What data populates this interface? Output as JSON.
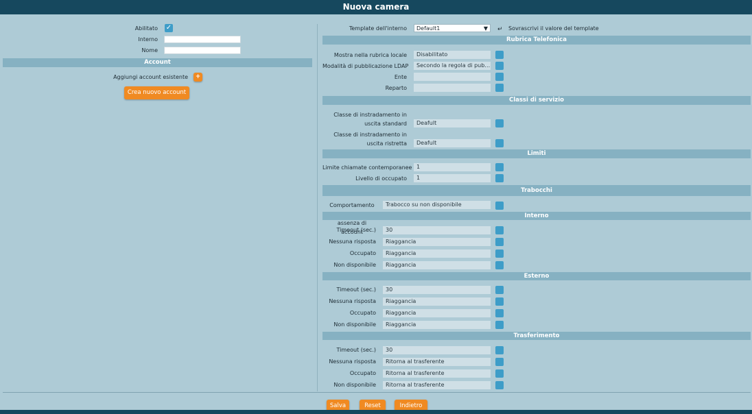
{
  "title": "Nuova camera",
  "left": {
    "abilitato_label": "Abilitato",
    "interno_label": "Interno",
    "interno_value": "",
    "nome_label": "Nome",
    "nome_value": "",
    "account_header": "Account",
    "add_existing_label": "Aggiungi account esistente",
    "add_icon": "+",
    "create_button": "Crea nuovo account"
  },
  "template": {
    "label": "Template dell'interno",
    "selected": "Default1",
    "override_label": "Sovrascrivi il valore del template",
    "override_icon": "undo-arrow-icon"
  },
  "sections": {
    "rubrica": {
      "title": "Rubrica Telefonica",
      "rows": [
        {
          "label": "Mostra nella rubrica locale",
          "value": "Disabilitato"
        },
        {
          "label": "Modalità di pubblicazione LDAP",
          "value": "Secondo la regola di pubblicazione"
        },
        {
          "label": "Ente",
          "value": ""
        },
        {
          "label": "Reparto",
          "value": ""
        }
      ]
    },
    "classi": {
      "title": "Classi di servizio",
      "rows": [
        {
          "label": "Classe di instradamento in uscita standard",
          "value": "Deafult"
        },
        {
          "label": "Classe di instradamento in uscita ristretta",
          "value": "Deafult"
        }
      ]
    },
    "limiti": {
      "title": "Limiti",
      "rows": [
        {
          "label": "Limite chiamate contemporanee",
          "value": "1"
        },
        {
          "label": "Livello di occupato",
          "value": "1"
        }
      ]
    },
    "trabocchi": {
      "title": "Trabocchi",
      "rows": [
        {
          "label": "Comportamento in caso di assenza di account",
          "value": "Trabocco su non disponibile"
        }
      ]
    },
    "interno": {
      "title": "Interno",
      "rows": [
        {
          "label": "Timeout (sec.)",
          "value": "30"
        },
        {
          "label": "Nessuna risposta",
          "value": "Riaggancia"
        },
        {
          "label": "Occupato",
          "value": "Riaggancia"
        },
        {
          "label": "Non disponibile",
          "value": "Riaggancia"
        }
      ]
    },
    "esterno": {
      "title": "Esterno",
      "rows": [
        {
          "label": "Timeout (sec.)",
          "value": "30"
        },
        {
          "label": "Nessuna risposta",
          "value": "Riaggancia"
        },
        {
          "label": "Occupato",
          "value": "Riaggancia"
        },
        {
          "label": "Non disponibile",
          "value": "Riaggancia"
        }
      ]
    },
    "trasferimento": {
      "title": "Trasferimento",
      "rows": [
        {
          "label": "Timeout (sec.)",
          "value": "30"
        },
        {
          "label": "Nessuna risposta",
          "value": "Ritorna al trasferente"
        },
        {
          "label": "Occupato",
          "value": "Ritorna al trasferente"
        },
        {
          "label": "Non disponibile",
          "value": "Ritorna al trasferente"
        }
      ]
    }
  },
  "footer": {
    "save": "Salva",
    "reset": "Reset",
    "back": "Indietro"
  },
  "colors": {
    "background": "#aecbd6",
    "titlebar": "#16485e",
    "section_bar": "#86b1c2",
    "accent_button": "#f08a22",
    "override_square": "#3e9dc8"
  }
}
